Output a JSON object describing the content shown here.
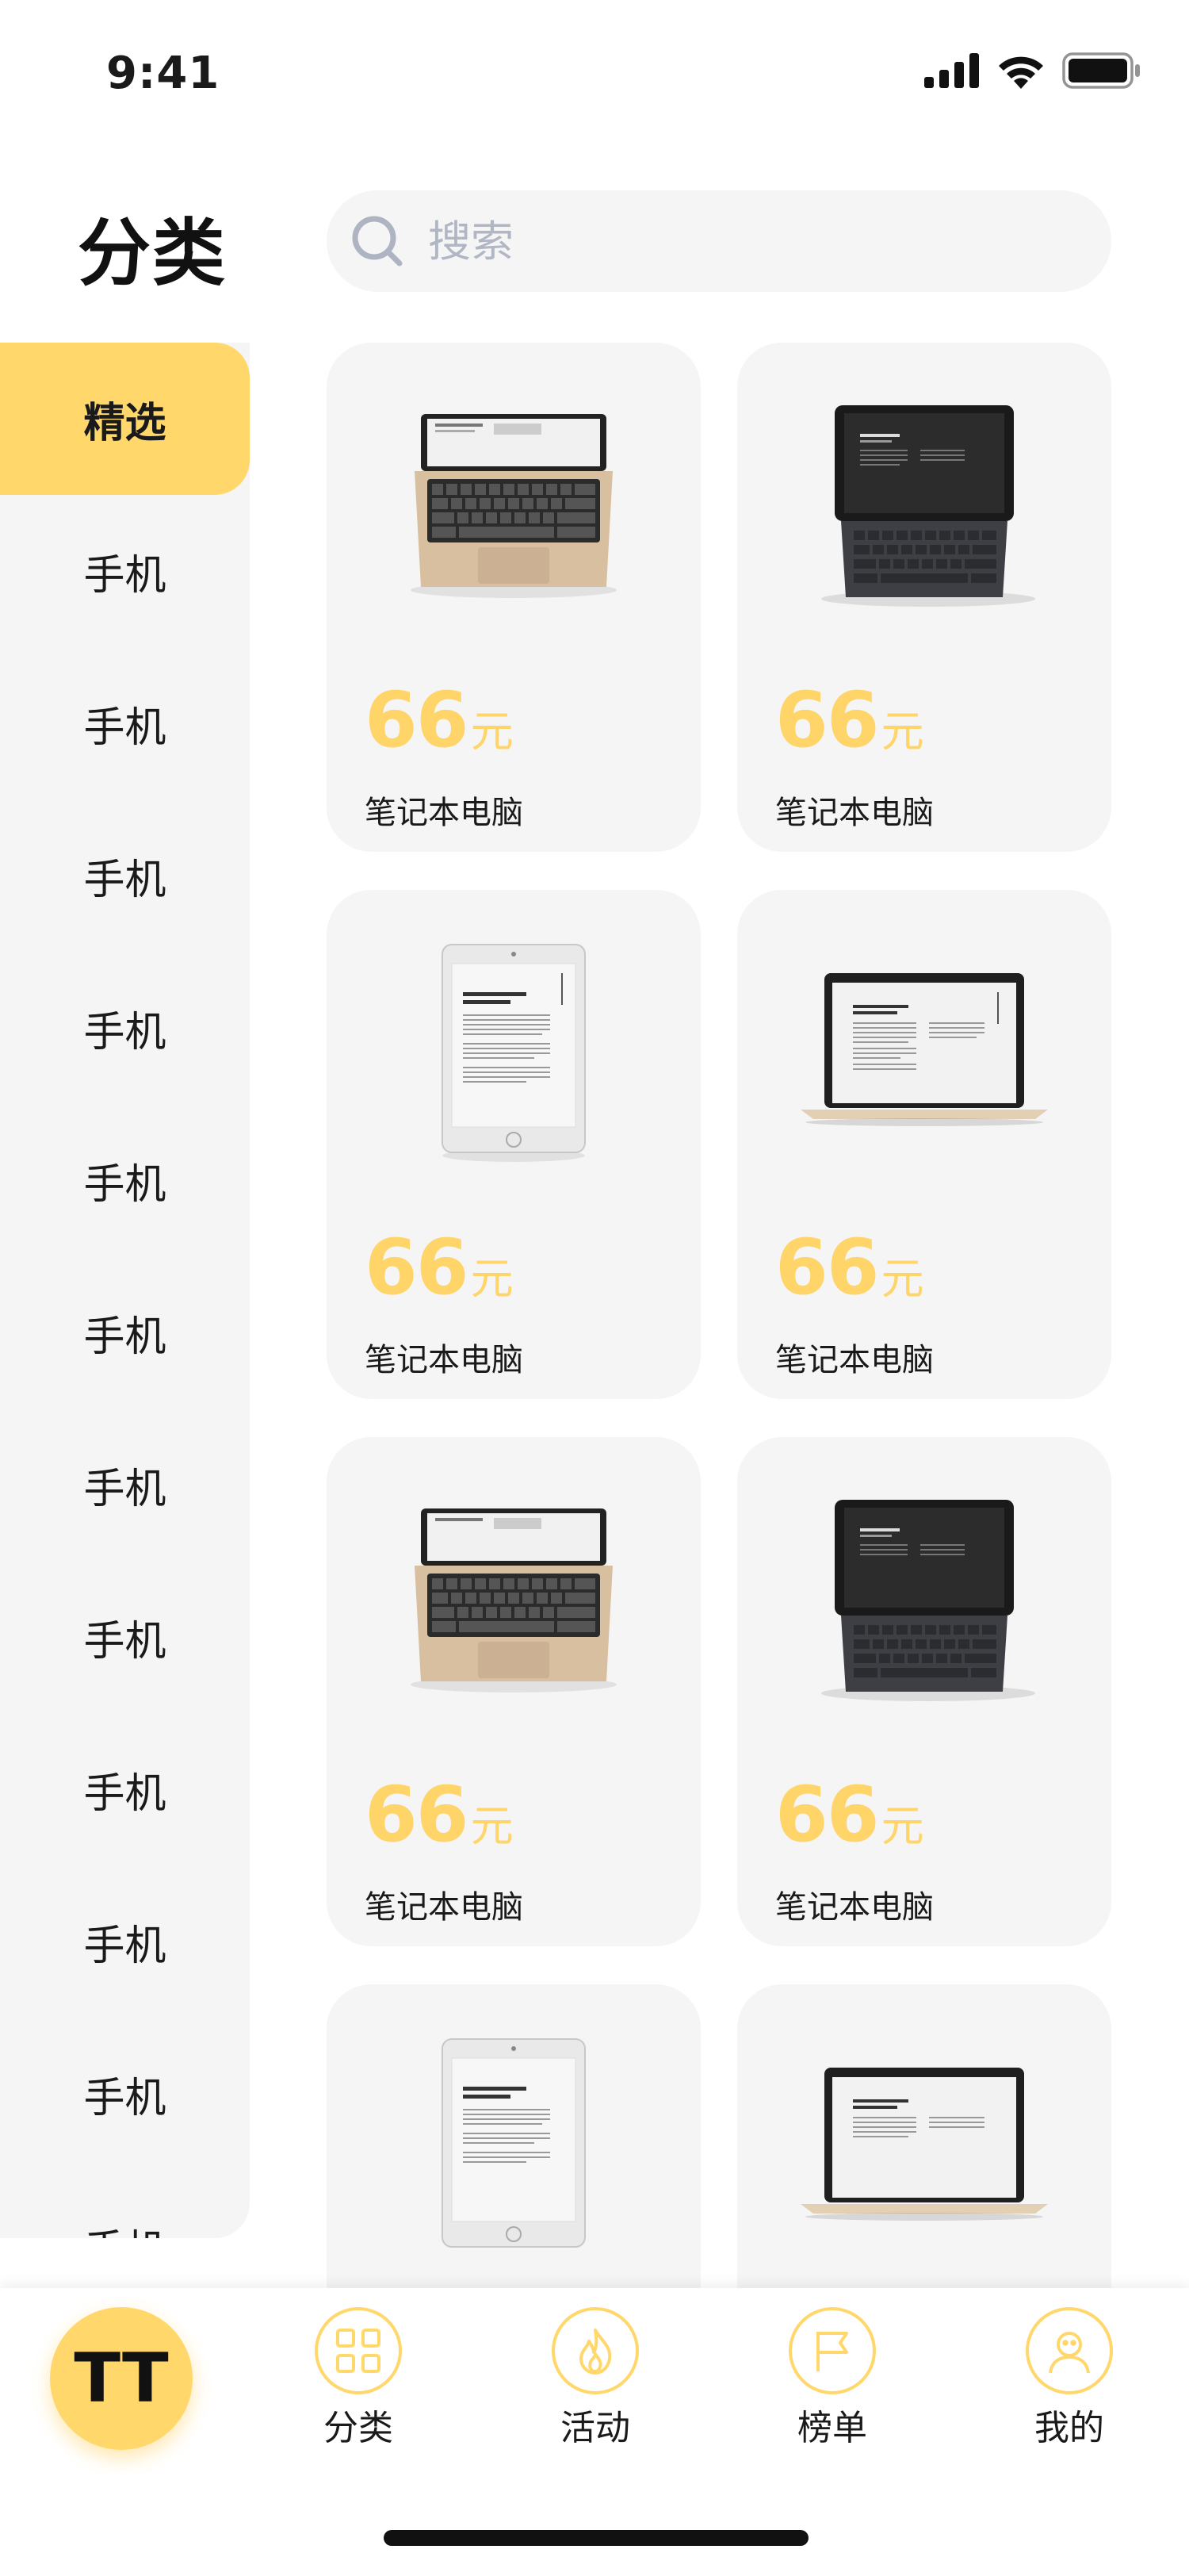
{
  "status_bar": {
    "time": "9:41"
  },
  "header": {
    "title": "分类",
    "search_placeholder": "搜索"
  },
  "sidebar": {
    "items": [
      {
        "label": "精选",
        "active": true
      },
      {
        "label": "手机"
      },
      {
        "label": "手机"
      },
      {
        "label": "手机"
      },
      {
        "label": "手机"
      },
      {
        "label": "手机"
      },
      {
        "label": "手机"
      },
      {
        "label": "手机"
      },
      {
        "label": "手机"
      },
      {
        "label": "手机"
      },
      {
        "label": "手机"
      },
      {
        "label": "手机"
      },
      {
        "label": "手机"
      }
    ]
  },
  "products": [
    {
      "price": "66",
      "unit": "元",
      "name": "笔记本电脑",
      "image": "gold-laptop"
    },
    {
      "price": "66",
      "unit": "元",
      "name": "笔记本电脑",
      "image": "tablet-keyboard"
    },
    {
      "price": "66",
      "unit": "元",
      "name": "笔记本电脑",
      "image": "tablet"
    },
    {
      "price": "66",
      "unit": "元",
      "name": "笔记本电脑",
      "image": "laptop-open"
    },
    {
      "price": "66",
      "unit": "元",
      "name": "笔记本电脑",
      "image": "gold-laptop"
    },
    {
      "price": "66",
      "unit": "元",
      "name": "笔记本电脑",
      "image": "tablet-keyboard"
    },
    {
      "price": "",
      "unit": "",
      "name": "",
      "image": "tablet"
    },
    {
      "price": "",
      "unit": "",
      "name": "",
      "image": "laptop-open"
    }
  ],
  "tabbar": {
    "fab_label": "TT",
    "tabs": [
      {
        "label": "分类",
        "icon": "category-icon"
      },
      {
        "label": "活动",
        "icon": "fire-icon"
      },
      {
        "label": "榜单",
        "icon": "flag-icon"
      },
      {
        "label": "我的",
        "icon": "profile-icon"
      }
    ]
  },
  "colors": {
    "accent": "#ffd76b",
    "price": "#ffd56a",
    "surface": "#f5f5f5"
  }
}
